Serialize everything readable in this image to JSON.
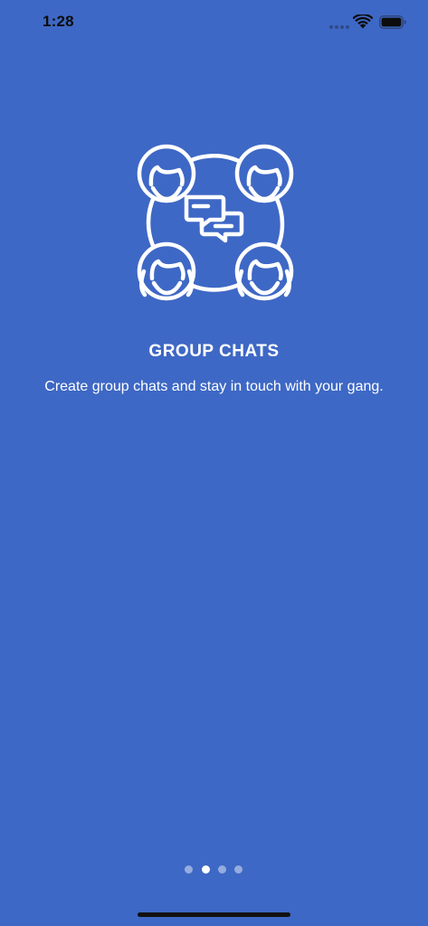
{
  "status_bar": {
    "time": "1:28",
    "icons": [
      "cellular-signal-icon",
      "wifi-icon",
      "battery-icon"
    ]
  },
  "onboarding": {
    "illustration_icon": "group-chat-icon",
    "title": "GROUP CHATS",
    "description": "Create group chats and stay in touch with your gang."
  },
  "pager": {
    "page_count": 4,
    "current_page": 2
  },
  "colors": {
    "background": "#3E68C5",
    "foreground": "#FFFFFF",
    "dot_inactive": "rgba(255,255,255,0.45)"
  }
}
